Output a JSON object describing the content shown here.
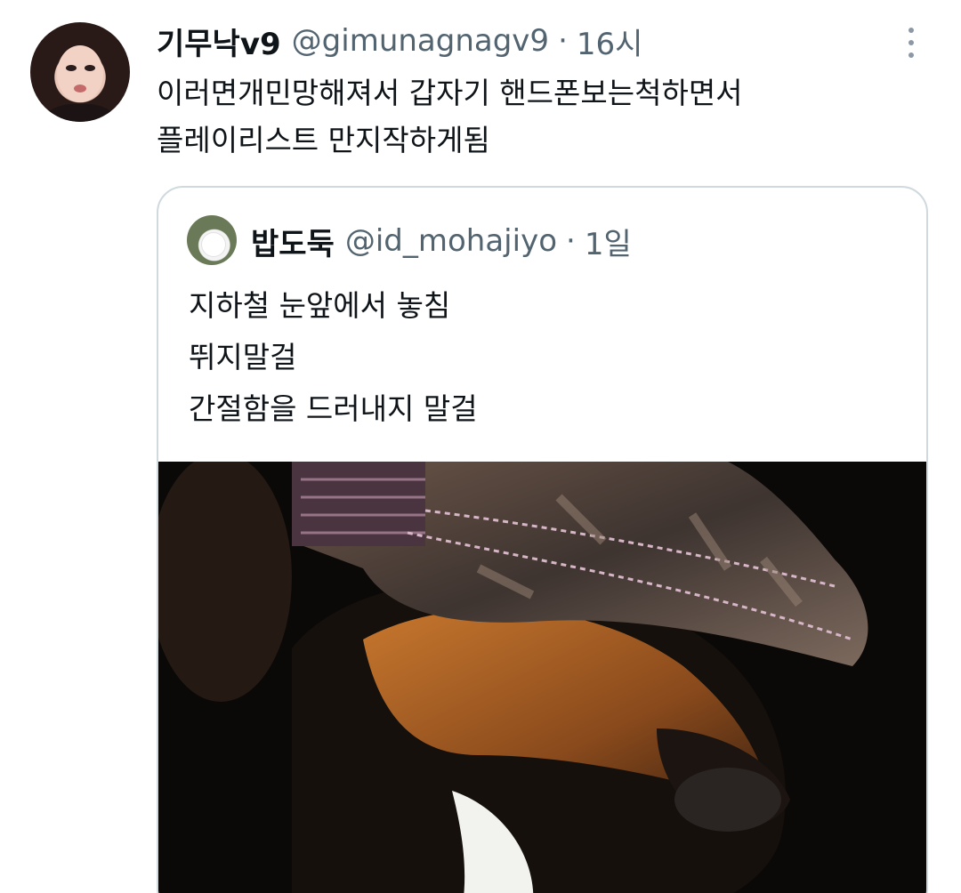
{
  "tweet": {
    "display_name": "기무낙v9",
    "handle": "@gimunagnagv9",
    "separator": "·",
    "time": "16시",
    "text_lines": [
      "이러면개민망해져서 갑자기 핸드폰보는척하면서",
      "플레이리스트 만지작하게됨"
    ],
    "icons": {
      "avatar": "user-avatar",
      "more": "more-options-icon"
    }
  },
  "quoted_tweet": {
    "display_name": "밥도둑",
    "handle": "@id_mohajiyo",
    "separator": "·",
    "time": "1일",
    "text_lines": [
      "지하철 눈앞에서 놓침",
      "뛰지말걸",
      "간절함을 드러내지 말걸"
    ],
    "media": {
      "type": "photo",
      "icon": "dog-wearing-camo-cap-photo"
    }
  },
  "colors": {
    "text_primary": "#0f1419",
    "text_secondary": "#536471",
    "border": "#cfd9de",
    "background": "#ffffff"
  }
}
